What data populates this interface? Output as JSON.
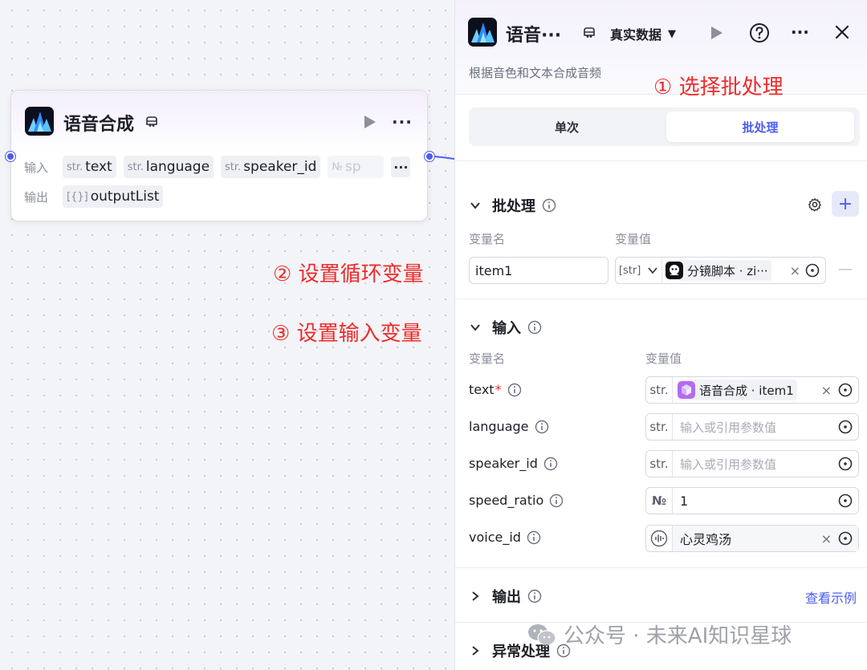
{
  "node": {
    "title": "语音合成",
    "input_label": "输入",
    "output_label": "输出",
    "inputs": [
      {
        "type": "str.",
        "name": "text"
      },
      {
        "type": "str.",
        "name": "language"
      },
      {
        "type": "str.",
        "name": "speaker_id"
      },
      {
        "type": "№",
        "name": "sp"
      }
    ],
    "more_inputs": "···",
    "outputs": [
      {
        "type": "[{}]",
        "name": "outputList"
      }
    ]
  },
  "annotations": {
    "step1": "① 选择批处理",
    "step2": "② 设置循环变量",
    "step3": "③ 设置输入变量"
  },
  "panel": {
    "title": "语音···",
    "data_source": "真实数据",
    "description": "根据音色和文本合成音频",
    "mode_tabs": {
      "single": "单次",
      "batch": "批处理",
      "active": "batch"
    },
    "batch_section": {
      "title": "批处理",
      "col_name": "变量名",
      "col_value": "变量值",
      "rows": [
        {
          "name": "item1",
          "type": "[str]",
          "ref_label": "分镜脚本 · zi···",
          "remove": "×",
          "minus": "—"
        }
      ],
      "add": "+"
    },
    "input_section": {
      "title": "输入",
      "col_name": "变量名",
      "col_value": "变量值",
      "params": [
        {
          "name": "text",
          "required": "*",
          "type": "str.",
          "ref_label": "语音合成 · item1",
          "placeholder": "",
          "remove": "×"
        },
        {
          "name": "language",
          "required": "",
          "type": "str.",
          "ref_label": "",
          "placeholder": "输入或引用参数值",
          "remove": ""
        },
        {
          "name": "speaker_id",
          "required": "",
          "type": "str.",
          "ref_label": "",
          "placeholder": "输入或引用参数值",
          "remove": ""
        },
        {
          "name": "speed_ratio",
          "required": "",
          "type": "№",
          "ref_label": "",
          "value": "1",
          "placeholder": "",
          "remove": ""
        },
        {
          "name": "voice_id",
          "required": "",
          "type": "voice",
          "ref_label": "心灵鸡汤",
          "placeholder": "",
          "remove": "×"
        }
      ]
    },
    "output_section": {
      "title": "输出",
      "link": "查看示例"
    },
    "error_section": {
      "title": "异常处理"
    }
  },
  "watermark": "公众号 · 未来AI知识星球",
  "colors": {
    "accent": "#4c5cf0",
    "annotation": "#ee2b2b",
    "port": "#4c5cf0"
  },
  "icons": [
    "app-logo-icon",
    "plugin-icon",
    "play-icon",
    "more-icon",
    "help-icon",
    "close-icon",
    "chevron-icon",
    "info-icon",
    "gear-icon",
    "target-icon",
    "wechat-icon"
  ]
}
